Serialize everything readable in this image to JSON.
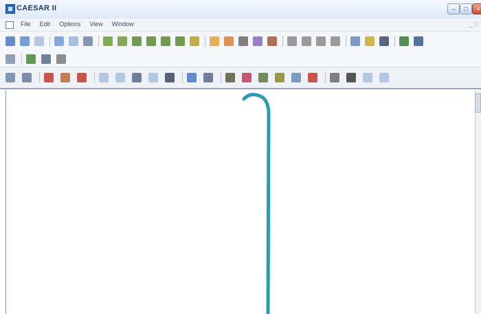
{
  "window": {
    "title": "CAESAR II"
  },
  "menu": {
    "items": [
      "File",
      "Edit",
      "Options",
      "View",
      "Window"
    ]
  },
  "toolbars": {
    "row1": [
      {
        "name": "zoom-icon",
        "color": "#4a78c2"
      },
      {
        "name": "undo-icon",
        "color": "#5f8ed0"
      },
      {
        "name": "redo-icon",
        "color": "#a9bfdc"
      },
      {
        "name": "zoom-window-icon",
        "color": "#6f9bd6"
      },
      {
        "name": "zoom-extents-icon",
        "color": "#9ab7de"
      },
      {
        "name": "grid-icon",
        "color": "#7086a6"
      },
      {
        "name": "view-iso1-icon",
        "color": "#6f9a3a"
      },
      {
        "name": "view-iso2-icon",
        "color": "#6f9a3a"
      },
      {
        "name": "view-front-icon",
        "color": "#5c8a34"
      },
      {
        "name": "view-back-icon",
        "color": "#5c8a34"
      },
      {
        "name": "view-top-icon",
        "color": "#5c8a34"
      },
      {
        "name": "view-bottom-icon",
        "color": "#5c8a34"
      },
      {
        "name": "view-side-icon",
        "color": "#b8a030"
      },
      {
        "name": "orbit-icon",
        "color": "#e6a23a"
      },
      {
        "name": "zoom-select-icon",
        "color": "#d9823a"
      },
      {
        "name": "pan-icon",
        "color": "#6a6a6a"
      },
      {
        "name": "light-icon",
        "color": "#8a6ab8"
      },
      {
        "name": "node-numbers-icon",
        "color": "#a05a3a"
      },
      {
        "name": "render-solid-icon",
        "color": "#8a8a8a"
      },
      {
        "name": "render-hidden-icon",
        "color": "#8a8a8a"
      },
      {
        "name": "render-wire-icon",
        "color": "#8a8a8a"
      },
      {
        "name": "render-outline-icon",
        "color": "#8a8a8a"
      },
      {
        "name": "pointer-icon",
        "color": "#6a88b8"
      },
      {
        "name": "text-icon",
        "color": "#c9a830"
      },
      {
        "name": "label-icon",
        "color": "#3a4a6a"
      },
      {
        "name": "print-icon",
        "color": "#3a7a3a"
      },
      {
        "name": "export-icon",
        "color": "#3a5a8a"
      }
    ],
    "row2": [
      {
        "name": "refresh-icon",
        "color": "#7f8fa6"
      },
      {
        "name": "element-icon",
        "color": "#4a8a3a"
      },
      {
        "name": "dimension-icon",
        "color": "#5a6a8a"
      },
      {
        "name": "restraint-icon",
        "color": "#7a7a7a"
      }
    ],
    "row3": [
      {
        "name": "grid-on-icon",
        "color": "#7086a6"
      },
      {
        "name": "range-icon",
        "color": "#6a7a96"
      },
      {
        "name": "line-style-icon",
        "color": "#c0392b"
      },
      {
        "name": "color-icon",
        "color": "#c06a3a"
      },
      {
        "name": "displacement-icon",
        "color": "#c0392b"
      },
      {
        "name": "tee-icon",
        "color": "#a9bfdc"
      },
      {
        "name": "bend-icon",
        "color": "#a9bfdc"
      },
      {
        "name": "force-icon",
        "color": "#5a6a8a"
      },
      {
        "name": "stress-icon",
        "color": "#a9bfdc"
      },
      {
        "name": "toggle-icon",
        "color": "#3a4a5a"
      },
      {
        "name": "flag-icon",
        "color": "#4a78c2"
      },
      {
        "name": "filter-icon",
        "color": "#5a6a8a"
      },
      {
        "name": "nozzle-icon",
        "color": "#5a5a3a"
      },
      {
        "name": "valve-icon",
        "color": "#b8405a"
      },
      {
        "name": "flange-icon",
        "color": "#5a7a3a"
      },
      {
        "name": "vessel-icon",
        "color": "#8a8a2a"
      },
      {
        "name": "properties-icon",
        "color": "#6a8ab8"
      },
      {
        "name": "thermometer-icon",
        "color": "#c0392b"
      },
      {
        "name": "circle-icon",
        "color": "#6a6a6a"
      },
      {
        "name": "find-icon",
        "color": "#3a3a3a"
      },
      {
        "name": "cut-icon",
        "color": "#a9bfdc"
      },
      {
        "name": "chart-icon",
        "color": "#a9bfdc"
      }
    ]
  },
  "colors": {
    "pipe": "#2e9ab0",
    "accent": "#2e6cc2"
  }
}
